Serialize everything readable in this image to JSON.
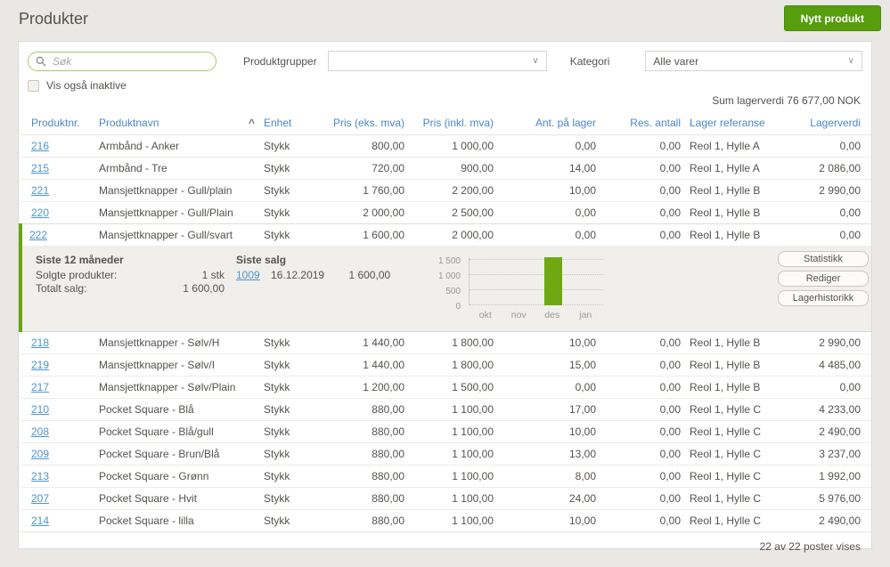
{
  "page": {
    "title": "Produkter"
  },
  "header": {
    "new_product_button": "Nytt produkt"
  },
  "filters": {
    "search_placeholder": "Søk",
    "show_inactive_label": "Vis også inaktive",
    "show_inactive_checked": false,
    "product_groups_label": "Produktgrupper",
    "product_groups_value": "",
    "category_label": "Kategori",
    "category_value": "Alle varer"
  },
  "summary": {
    "sum_stock_value": "Sum lagerverdi 76 677,00 NOK"
  },
  "table": {
    "columns": [
      "Produktnr.",
      "Produktnavn",
      "Enhet",
      "Pris (eks. mva)",
      "Pris (inkl. mva)",
      "Ant. på lager",
      "Res. antall",
      "Lager referanse",
      "Lagerverdi"
    ],
    "sort": {
      "column": "Produktnavn",
      "direction": "ascending"
    },
    "rows": [
      {
        "nr": "216",
        "name": "Armbånd - Anker",
        "unit": "Stykk",
        "price_ex": "800,00",
        "price_inc": "1 000,00",
        "stock": "0,00",
        "reserved": "0,00",
        "location": "Reol 1, Hylle A",
        "value": "0,00",
        "selected": false
      },
      {
        "nr": "215",
        "name": "Armbånd - Tre",
        "unit": "Stykk",
        "price_ex": "720,00",
        "price_inc": "900,00",
        "stock": "14,00",
        "reserved": "0,00",
        "location": "Reol 1, Hylle A",
        "value": "2 086,00",
        "selected": false
      },
      {
        "nr": "221",
        "name": "Mansjettknapper - Gull/plain",
        "unit": "Stykk",
        "price_ex": "1 760,00",
        "price_inc": "2 200,00",
        "stock": "10,00",
        "reserved": "0,00",
        "location": "Reol 1, Hylle B",
        "value": "2 990,00",
        "selected": false
      },
      {
        "nr": "220",
        "name": "Mansjettknapper - Gull/Plain",
        "unit": "Stykk",
        "price_ex": "2 000,00",
        "price_inc": "2 500,00",
        "stock": "0,00",
        "reserved": "0,00",
        "location": "Reol 1, Hylle B",
        "value": "0,00",
        "selected": false
      },
      {
        "nr": "222",
        "name": "Mansjettknapper - Gull/svart",
        "unit": "Stykk",
        "price_ex": "1 600,00",
        "price_inc": "2 000,00",
        "stock": "0,00",
        "reserved": "0,00",
        "location": "Reol 1, Hylle B",
        "value": "0,00",
        "selected": true
      },
      {
        "nr": "218",
        "name": "Mansjettknapper - Sølv/H",
        "unit": "Stykk",
        "price_ex": "1 440,00",
        "price_inc": "1 800,00",
        "stock": "10,00",
        "reserved": "0,00",
        "location": "Reol 1, Hylle B",
        "value": "2 990,00",
        "selected": false
      },
      {
        "nr": "219",
        "name": "Mansjettknapper - Sølv/I",
        "unit": "Stykk",
        "price_ex": "1 440,00",
        "price_inc": "1 800,00",
        "stock": "15,00",
        "reserved": "0,00",
        "location": "Reol 1, Hylle B",
        "value": "4 485,00",
        "selected": false
      },
      {
        "nr": "217",
        "name": "Mansjettknapper - Sølv/Plain",
        "unit": "Stykk",
        "price_ex": "1 200,00",
        "price_inc": "1 500,00",
        "stock": "0,00",
        "reserved": "0,00",
        "location": "Reol 1, Hylle B",
        "value": "0,00",
        "selected": false
      },
      {
        "nr": "210",
        "name": "Pocket Square - Blå",
        "unit": "Stykk",
        "price_ex": "880,00",
        "price_inc": "1 100,00",
        "stock": "17,00",
        "reserved": "0,00",
        "location": "Reol 1, Hylle C",
        "value": "4 233,00",
        "selected": false
      },
      {
        "nr": "208",
        "name": "Pocket Square - Blå/gull",
        "unit": "Stykk",
        "price_ex": "880,00",
        "price_inc": "1 100,00",
        "stock": "10,00",
        "reserved": "0,00",
        "location": "Reol 1, Hylle C",
        "value": "2 490,00",
        "selected": false
      },
      {
        "nr": "209",
        "name": "Pocket Square - Brun/Blå",
        "unit": "Stykk",
        "price_ex": "880,00",
        "price_inc": "1 100,00",
        "stock": "13,00",
        "reserved": "0,00",
        "location": "Reol 1, Hylle C",
        "value": "3 237,00",
        "selected": false
      },
      {
        "nr": "213",
        "name": "Pocket Square - Grønn",
        "unit": "Stykk",
        "price_ex": "880,00",
        "price_inc": "1 100,00",
        "stock": "8,00",
        "reserved": "0,00",
        "location": "Reol 1, Hylle C",
        "value": "1 992,00",
        "selected": false
      },
      {
        "nr": "207",
        "name": "Pocket Square - Hvit",
        "unit": "Stykk",
        "price_ex": "880,00",
        "price_inc": "1 100,00",
        "stock": "24,00",
        "reserved": "0,00",
        "location": "Reol 1, Hylle C",
        "value": "5 976,00",
        "selected": false
      },
      {
        "nr": "214",
        "name": "Pocket Square - lilla",
        "unit": "Stykk",
        "price_ex": "880,00",
        "price_inc": "1 100,00",
        "stock": "10,00",
        "reserved": "0,00",
        "location": "Reol 1, Hylle C",
        "value": "2 490,00",
        "selected": false
      }
    ],
    "footer": "22 av 22 poster vises"
  },
  "detail_panel": {
    "last_12_months": {
      "title": "Siste 12 måneder",
      "sold_label": "Solgte produkter:",
      "sold_value": "1 stk",
      "total_label": "Totalt salg:",
      "total_value": "1 600,00"
    },
    "last_sale": {
      "title": "Siste salg",
      "invoice_number": "1009",
      "date": "16.12.2019",
      "amount": "1 600,00"
    },
    "buttons": [
      "Statistikk",
      "Rediger",
      "Lagerhistorikk"
    ]
  },
  "chart_data": {
    "type": "bar",
    "categories": [
      "okt",
      "nov",
      "des",
      "jan"
    ],
    "values": [
      0,
      0,
      1600,
      0
    ],
    "title": "",
    "xlabel": "",
    "ylabel": "",
    "ylim": [
      0,
      1600
    ],
    "yticks": [
      0,
      500,
      1000,
      1500
    ],
    "ytick_labels": [
      "0",
      "500",
      "1 000",
      "1 500"
    ],
    "legend": "none",
    "grid": "horizontal-dotted",
    "bar_color": "#6fa813"
  },
  "icons": {
    "search": "magnifier",
    "sort_ascending": "^",
    "dropdown_chevron": "∨"
  },
  "colors": {
    "accent_green": "#579d0e",
    "bar_green": "#6fa813",
    "header_blue": "#4a87c7",
    "link_blue": "#4f94cd",
    "selected_left_border": "#6aa414"
  }
}
